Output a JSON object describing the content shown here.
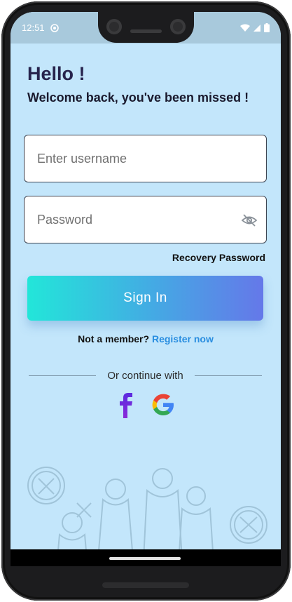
{
  "status_bar": {
    "time": "12:51"
  },
  "header": {
    "greeting": "Hello !",
    "subtitle": "Welcome back, you've been missed !"
  },
  "form": {
    "username_placeholder": "Enter username",
    "username_value": "",
    "password_placeholder": "Password",
    "password_value": ""
  },
  "links": {
    "recovery": "Recovery Password",
    "not_member": "Not a member?",
    "register": "Register now"
  },
  "buttons": {
    "sign_in": "Sign In"
  },
  "social": {
    "divider_text": "Or continue with",
    "providers": [
      "facebook-icon",
      "google-icon"
    ]
  },
  "colors": {
    "background": "#c3e6fb",
    "gradient_start": "#22e6d9",
    "gradient_end": "#6578e9",
    "link": "#2a8ee0",
    "heading": "#27244d"
  }
}
